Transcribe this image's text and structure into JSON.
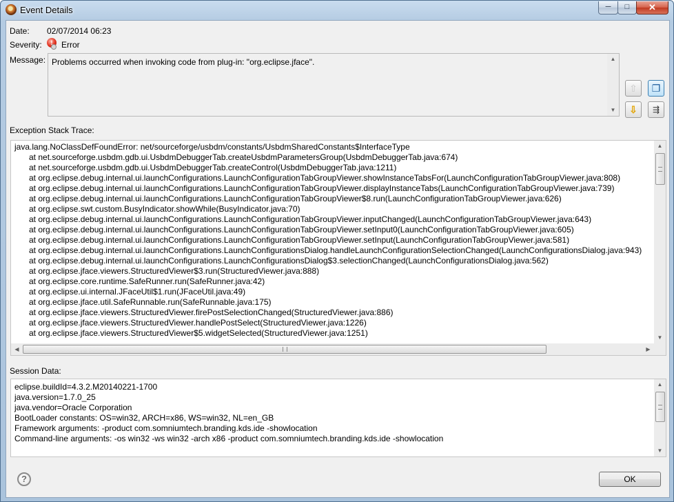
{
  "window": {
    "title": "Event Details",
    "controls": {
      "minimize_glyph": "─",
      "maximize_glyph": "□",
      "close_glyph": "✕"
    }
  },
  "details": {
    "date_label": "Date:",
    "date_value": "02/07/2014 06:23",
    "severity_label": "Severity:",
    "severity_value": "Error",
    "message_label": "Message:",
    "message_text": "Problems occurred when invoking code from plug-in: \"org.eclipse.jface\"."
  },
  "side_buttons": [
    {
      "name": "previous-event-button",
      "icon": "arrow-up-icon",
      "glyph": "⇧"
    },
    {
      "name": "copy-event-button",
      "icon": "clipboard-icon",
      "glyph": "❐"
    },
    {
      "name": "next-event-button",
      "icon": "arrow-down-icon",
      "glyph": "⇩"
    },
    {
      "name": "event-filter-button",
      "icon": "filter-icon",
      "glyph": "⇶"
    }
  ],
  "stack_trace": {
    "label": "Exception Stack Trace:",
    "lines": [
      "java.lang.NoClassDefFoundError: net/sourceforge/usbdm/constants/UsbdmSharedConstants$InterfaceType",
      "at net.sourceforge.usbdm.gdb.ui.UsbdmDebuggerTab.createUsbdmParametersGroup(UsbdmDebuggerTab.java:674)",
      "at net.sourceforge.usbdm.gdb.ui.UsbdmDebuggerTab.createControl(UsbdmDebuggerTab.java:1211)",
      "at org.eclipse.debug.internal.ui.launchConfigurations.LaunchConfigurationTabGroupViewer.showInstanceTabsFor(LaunchConfigurationTabGroupViewer.java:808)",
      "at org.eclipse.debug.internal.ui.launchConfigurations.LaunchConfigurationTabGroupViewer.displayInstanceTabs(LaunchConfigurationTabGroupViewer.java:739)",
      "at org.eclipse.debug.internal.ui.launchConfigurations.LaunchConfigurationTabGroupViewer$8.run(LaunchConfigurationTabGroupViewer.java:626)",
      "at org.eclipse.swt.custom.BusyIndicator.showWhile(BusyIndicator.java:70)",
      "at org.eclipse.debug.internal.ui.launchConfigurations.LaunchConfigurationTabGroupViewer.inputChanged(LaunchConfigurationTabGroupViewer.java:643)",
      "at org.eclipse.debug.internal.ui.launchConfigurations.LaunchConfigurationTabGroupViewer.setInput0(LaunchConfigurationTabGroupViewer.java:605)",
      "at org.eclipse.debug.internal.ui.launchConfigurations.LaunchConfigurationTabGroupViewer.setInput(LaunchConfigurationTabGroupViewer.java:581)",
      "at org.eclipse.debug.internal.ui.launchConfigurations.LaunchConfigurationsDialog.handleLaunchConfigurationSelectionChanged(LaunchConfigurationsDialog.java:943)",
      "at org.eclipse.debug.internal.ui.launchConfigurations.LaunchConfigurationsDialog$3.selectionChanged(LaunchConfigurationsDialog.java:562)",
      "at org.eclipse.jface.viewers.StructuredViewer$3.run(StructuredViewer.java:888)",
      "at org.eclipse.core.runtime.SafeRunner.run(SafeRunner.java:42)",
      "at org.eclipse.ui.internal.JFaceUtil$1.run(JFaceUtil.java:49)",
      "at org.eclipse.jface.util.SafeRunnable.run(SafeRunnable.java:175)",
      "at org.eclipse.jface.viewers.StructuredViewer.firePostSelectionChanged(StructuredViewer.java:886)",
      "at org.eclipse.jface.viewers.StructuredViewer.handlePostSelect(StructuredViewer.java:1226)",
      "at org.eclipse.jface.viewers.StructuredViewer$5.widgetSelected(StructuredViewer.java:1251)"
    ]
  },
  "session": {
    "label": "Session Data:",
    "lines": [
      "eclipse.buildId=4.3.2.M20140221-1700",
      "java.version=1.7.0_25",
      "java.vendor=Oracle Corporation",
      "BootLoader constants: OS=win32, ARCH=x86, WS=win32, NL=en_GB",
      "Framework arguments:  -product com.somniumtech.branding.kds.ide -showlocation",
      "Command-line arguments:  -os win32 -ws win32 -arch x86 -product com.somniumtech.branding.kds.ide -showlocation"
    ]
  },
  "footer": {
    "help_glyph": "?",
    "ok_label": "OK"
  }
}
